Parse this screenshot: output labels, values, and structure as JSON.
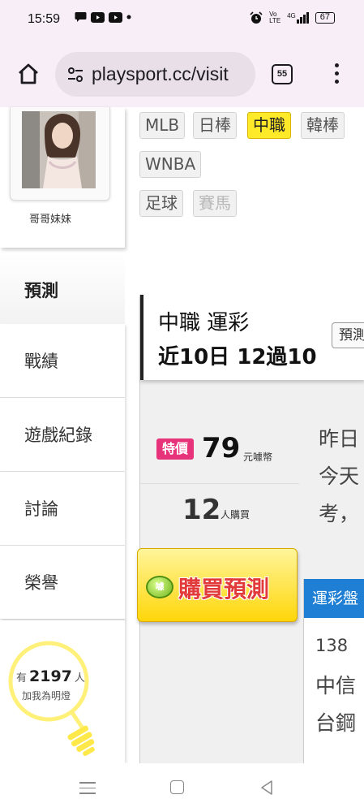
{
  "status_bar": {
    "time": "15:59",
    "network": "4G",
    "volte": "Vo LTE",
    "battery": "67"
  },
  "browser": {
    "url": "playsport.cc/visit",
    "tab_count": "55"
  },
  "sidebar": {
    "profile_name": "哥哥妹妹",
    "nav": [
      {
        "label": "預測",
        "active": true
      },
      {
        "label": "戰績"
      },
      {
        "label": "遊戲紀錄"
      },
      {
        "label": "討論"
      },
      {
        "label": "榮譽"
      }
    ],
    "fans": {
      "prefix": "有",
      "count": "2197",
      "suffix": "人",
      "caption": "加我為明燈"
    }
  },
  "tags": [
    {
      "label": "MLB"
    },
    {
      "label": "日棒"
    },
    {
      "label": "中職",
      "active": true
    },
    {
      "label": "韓棒"
    },
    {
      "label": "WNBA"
    },
    {
      "label": "足球"
    },
    {
      "label": "賽馬",
      "disabled": true
    }
  ],
  "panel": {
    "title": "中職 運彩",
    "record": "近10日 12過10",
    "predict_button": "預測",
    "special_label": "特價",
    "price": "79",
    "price_unit": "元噱幣",
    "buyers": "12",
    "buyers_unit": "人購買",
    "snippet_lines": [
      "昨日",
      "今天",
      "考，"
    ],
    "buy_button": "購買預測",
    "buy_coin": "噱",
    "lottery_header": "運彩盤",
    "game_no": "138",
    "team_1": "中信",
    "team_2": "台鋼"
  },
  "colors": {
    "active_tag": "#ffea2a",
    "special_badge": "#e6337a",
    "lottery_header": "#1e7fd4",
    "bulb": "#fff07a"
  }
}
